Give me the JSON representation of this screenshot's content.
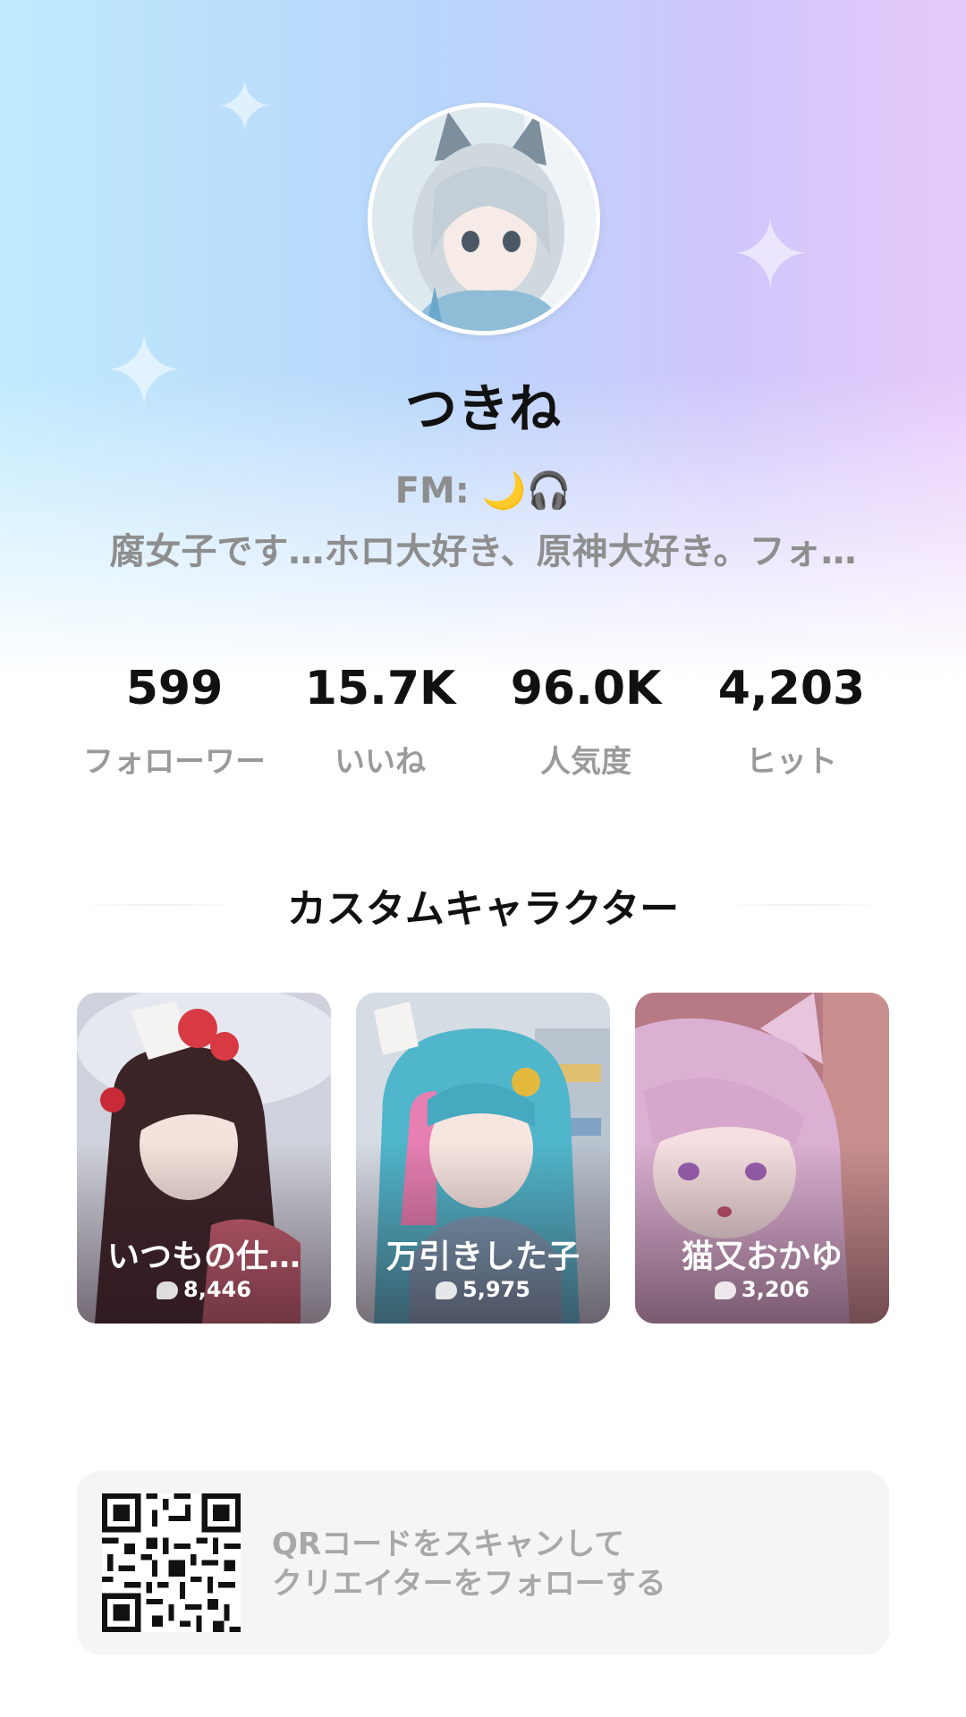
{
  "profile": {
    "name": "つきね",
    "bio_line1": "FM: 🌙🎧",
    "bio_line2": "腐女子です…ホロ大好き、原神大好き。フォ…"
  },
  "stats": [
    {
      "value": "599",
      "label": "フォローワー"
    },
    {
      "value": "15.7K",
      "label": "いいね"
    },
    {
      "value": "96.0K",
      "label": "人気度"
    },
    {
      "value": "4,203",
      "label": "ヒット"
    }
  ],
  "section": {
    "title": "カスタムキャラクター"
  },
  "characters": [
    {
      "name": "いつもの仕…",
      "chats": "8,446",
      "icon": "chat-bubble-icon"
    },
    {
      "name": "万引きした子",
      "chats": "5,975",
      "icon": "chat-bubble-icon"
    },
    {
      "name": "猫又おかゆ",
      "chats": "3,206",
      "icon": "chat-bubble-icon"
    }
  ],
  "qr": {
    "line1": "QRコードをスキャンして",
    "line2": "クリエイターをフォローする"
  },
  "colors": {
    "gradient_left": "#bfeafd",
    "gradient_right": "#e6cafb",
    "text_primary": "#111111",
    "text_secondary": "#8e8e8e"
  }
}
